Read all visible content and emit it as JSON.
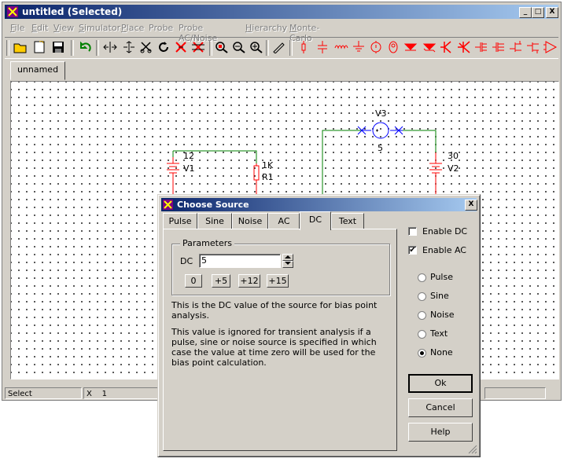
{
  "window": {
    "title": "untitled (Selected)",
    "min_icon": "_",
    "max_icon": "□",
    "close_icon": "X"
  },
  "menu": [
    {
      "label": "File",
      "hotkey": "F",
      "rest": "ile"
    },
    {
      "label": "Edit",
      "hotkey": "E",
      "rest": "dit"
    },
    {
      "label": "View",
      "hotkey": "V",
      "rest": "iew"
    },
    {
      "label": "Simulator",
      "hotkey": "S",
      "rest": "imulator"
    },
    {
      "label": "Place",
      "hotkey": "P",
      "rest": "lace"
    },
    {
      "label": "Probe",
      "hotkey": "",
      "rest": "Probe"
    },
    {
      "label": "Probe AC/Noise",
      "hotkey": "",
      "rest": "Probe AC/Noise"
    },
    {
      "label": "Hierarchy",
      "hotkey": "H",
      "rest": "ierarchy"
    },
    {
      "label": "Monte-Carlo",
      "hotkey": "M",
      "rest": "onte-Carlo"
    }
  ],
  "toolbar": {
    "icons": [
      "open-folder-icon",
      "new-file-icon",
      "save-disk-icon",
      "undo-icon",
      "flip-horizontal-icon",
      "flip-vertical-icon",
      "cut-scissors-icon",
      "rotate-icon",
      "delete-icon",
      "delete-wire-icon",
      "zoom-area-icon",
      "zoom-out-icon",
      "zoom-in-icon",
      "pencil-wire-icon",
      "resistor-icon",
      "capacitor-icon",
      "inductor-icon",
      "ground-icon",
      "voltage-source-icon",
      "current-source-icon",
      "diode-icon",
      "zener-diode-icon",
      "npn-transistor-icon",
      "pnp-transistor-icon",
      "nmos-icon",
      "pmos-icon",
      "njfet-icon",
      "pjfet-icon",
      "opamp-icon"
    ],
    "accent": "#ff0000"
  },
  "document_tab": "unnamed",
  "schematic": {
    "labels": [
      {
        "id": "v3",
        "text": "V3"
      },
      {
        "id": "v3val",
        "text": "5"
      },
      {
        "id": "v1val",
        "text": "12"
      },
      {
        "id": "v1",
        "text": "V1"
      },
      {
        "id": "r1val",
        "text": "1K"
      },
      {
        "id": "r1",
        "text": "R1"
      },
      {
        "id": "v2val",
        "text": "30"
      },
      {
        "id": "v2",
        "text": "V2"
      }
    ],
    "wire_color": "#008000",
    "part_color": "#ff0000",
    "source_color": "#0000ff"
  },
  "status": {
    "mode": "Select",
    "x_label": "X",
    "x_value": "1"
  },
  "dialog": {
    "title": "Choose Source",
    "close_icon": "X",
    "tabs": [
      "Pulse",
      "Sine",
      "Noise",
      "AC",
      "DC",
      "Text"
    ],
    "active_tab": "DC",
    "parameters_label": "Parameters",
    "dc_label": "DC",
    "dc_value": "5",
    "preset_buttons": [
      "0",
      "+5",
      "+12",
      "+15"
    ],
    "help_text_1": "This is the DC value of the source for bias point analysis.",
    "help_text_2": "This value is ignored for transient analysis if a pulse, sine or noise source is specified in which case the value at time zero will be used for the bias point calculation.",
    "enable_dc": {
      "label": "Enable DC",
      "checked": false
    },
    "enable_ac": {
      "label": "Enable AC",
      "checked": true
    },
    "options": [
      {
        "label": "Pulse",
        "selected": false
      },
      {
        "label": "Sine",
        "selected": false
      },
      {
        "label": "Noise",
        "selected": false
      },
      {
        "label": "Text",
        "selected": false
      },
      {
        "label": "None",
        "selected": true
      }
    ],
    "buttons": {
      "ok": "Ok",
      "cancel": "Cancel",
      "help": "Help"
    }
  }
}
